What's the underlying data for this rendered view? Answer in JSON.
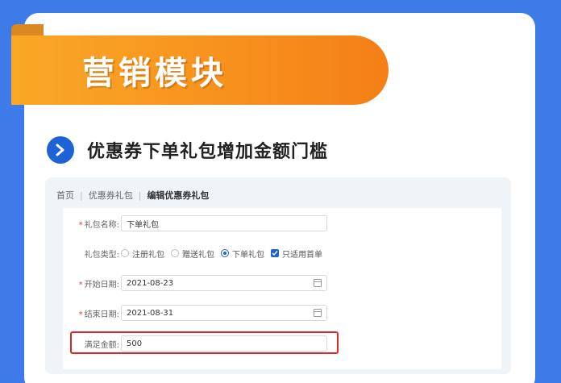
{
  "banner": {
    "title": "营销模块"
  },
  "section": {
    "title": "优惠券下单礼包增加金额门槛",
    "icon": "chevron-right-icon"
  },
  "breadcrumb": {
    "home": "首页",
    "parent": "优惠券礼包",
    "current": "编辑优惠券礼包"
  },
  "form": {
    "name": {
      "label": "礼包名称:",
      "value": "下单礼包",
      "required": true
    },
    "type": {
      "label": "礼包类型:",
      "options": [
        "注册礼包",
        "赠送礼包",
        "下单礼包"
      ],
      "selected": "下单礼包",
      "checkbox_label": "只适用首单",
      "checkbox_checked": true
    },
    "start_date": {
      "label": "开始日期:",
      "value": "2021-08-23",
      "required": true
    },
    "end_date": {
      "label": "结束日期:",
      "value": "2021-08-31",
      "required": true
    },
    "min_amount": {
      "label": "满足金额:",
      "value": "500"
    }
  },
  "colors": {
    "background": "#3f7be8",
    "banner": "#f7921e",
    "accent": "#1e63d6",
    "highlight": "#e02424"
  }
}
